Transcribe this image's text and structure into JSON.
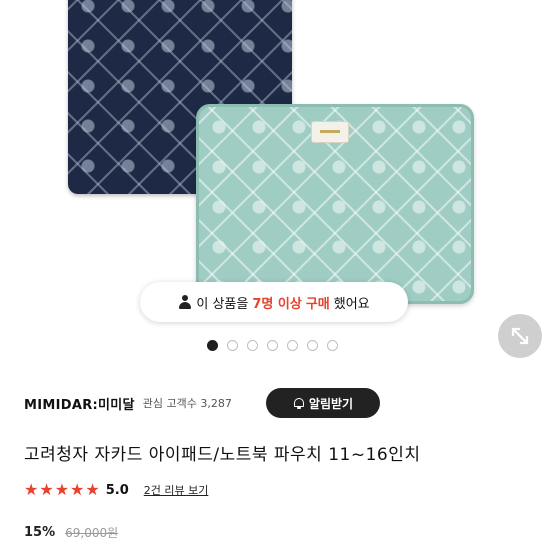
{
  "product_image": {
    "buyers_notice": {
      "prefix": "이 상품을",
      "count": "7명 이상",
      "action": "구매",
      "suffix": "했어요"
    },
    "carousel": {
      "total": 7,
      "active_index": 0
    }
  },
  "shop": {
    "name": "MIMIDAR:미미달",
    "followers": "관심 고객수 3,287",
    "follow_label": "알림받기"
  },
  "product": {
    "title": "고려청자 자카드 아이패드/노트북 파우치 11~16인치",
    "rating": "5.0",
    "stars": 5,
    "review_link": "2건 리뷰 보기",
    "discount": "15%",
    "original_price": "69,000원"
  },
  "colors": {
    "accent": "#e8412c",
    "navy_pouch": "#1e2a45",
    "mint_pouch": "#9fcdc4"
  },
  "icons": {
    "person": "person-icon",
    "bell": "bell-icon",
    "expand": "expand-icon",
    "star": "star-icon"
  }
}
